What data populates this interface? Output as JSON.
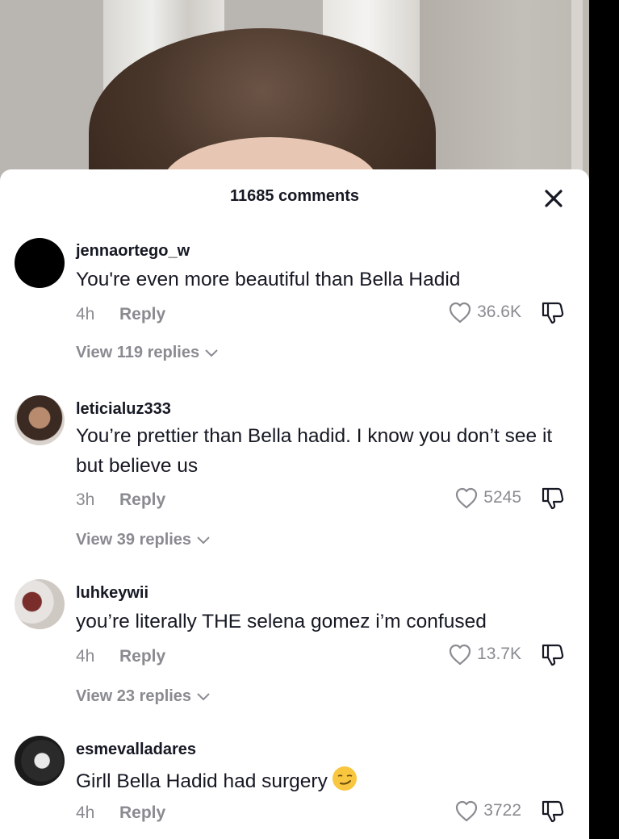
{
  "header": {
    "title": "11685 comments"
  },
  "icons": {
    "close": "close-icon",
    "like": "heart-icon",
    "dislike": "thumbs-down-icon",
    "expand": "chevron-down-icon"
  },
  "comments": [
    {
      "username": "jennaortego_w",
      "text": "You're even more beautiful than Bella Hadid",
      "time": "4h",
      "reply": "Reply",
      "likes": "36.6K",
      "view_replies": "View 119 replies"
    },
    {
      "username": "leticialuz333",
      "text": "You’re prettier than Bella hadid. I know you don’t see it but believe us",
      "time": "3h",
      "reply": "Reply",
      "likes": "5245",
      "view_replies": "View 39 replies"
    },
    {
      "username": "luhkeywii",
      "text": "you’re literally THE selena gomez i’m confused",
      "time": "4h",
      "reply": "Reply",
      "likes": "13.7K",
      "view_replies": "View 23 replies"
    },
    {
      "username": "esmevalladares",
      "text": "Girll Bella Hadid had surgery",
      "emoji": "smirking-face-emoji",
      "time": "4h",
      "reply": "Reply",
      "likes": "3722"
    }
  ]
}
